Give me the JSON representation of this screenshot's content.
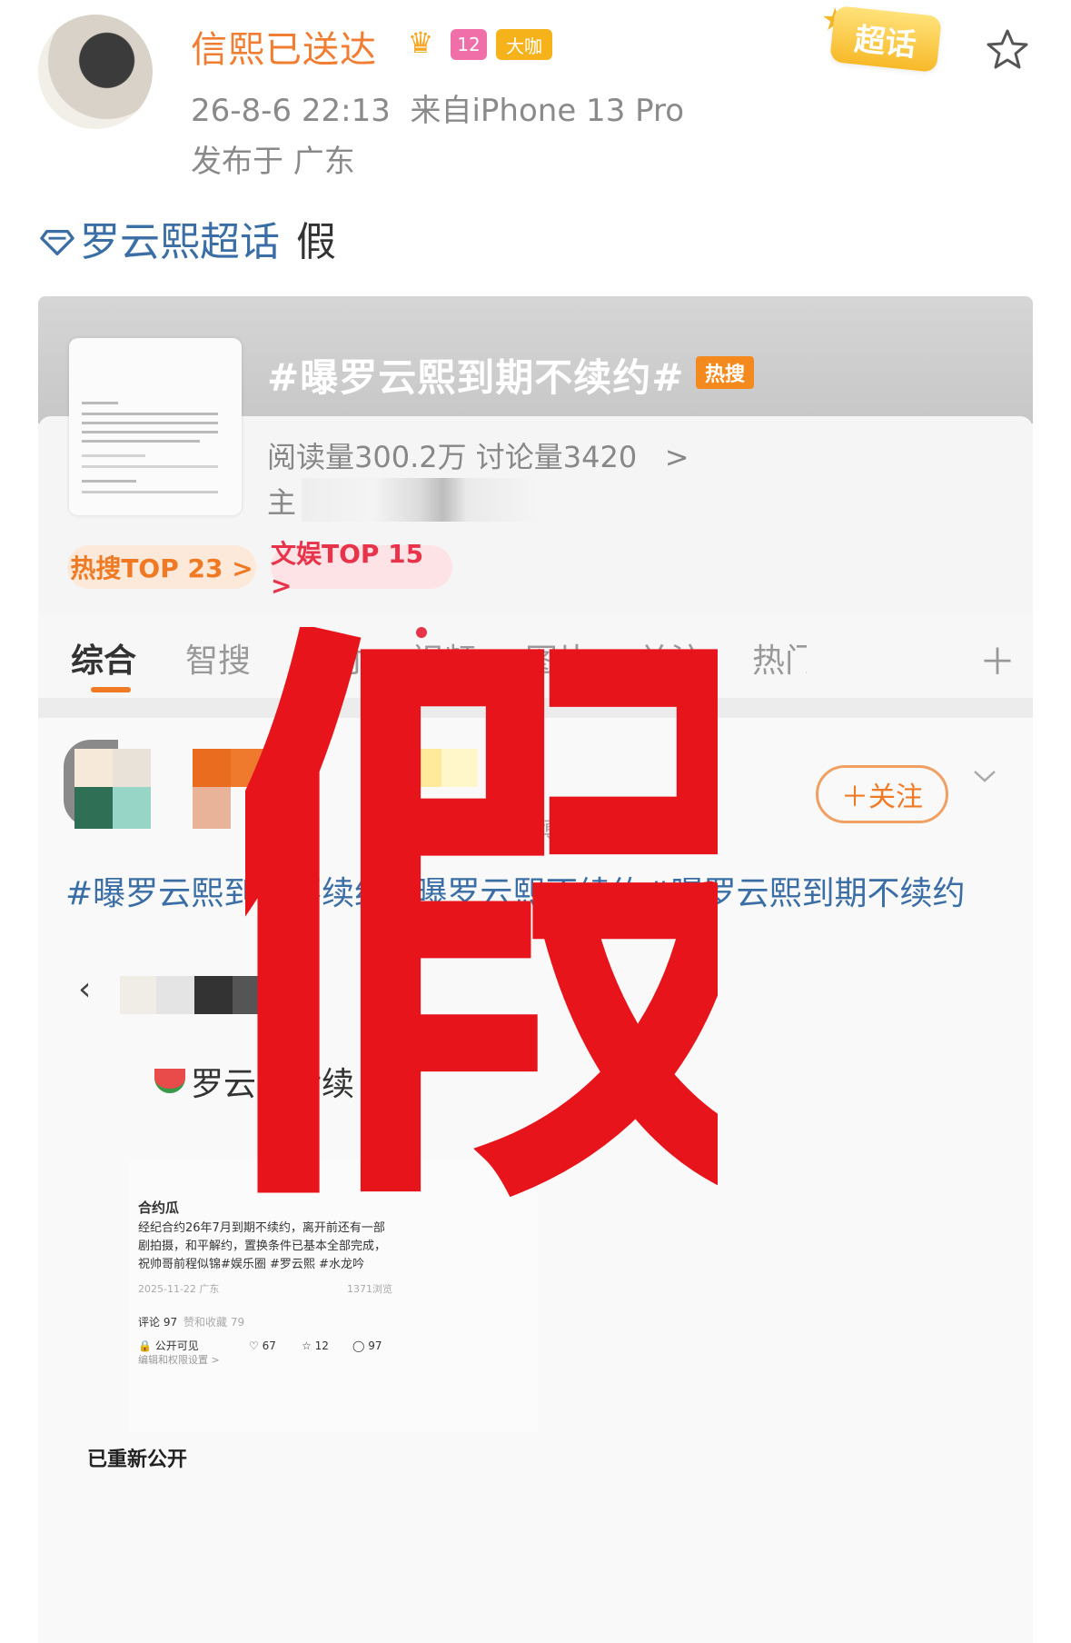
{
  "header": {
    "username": "信熙已送达",
    "level_badge": "12",
    "vip_badge": "大咖",
    "timestamp": "26-8-6 22:13",
    "source": "来自iPhone 13 Pro",
    "location": "发布于 广东",
    "chaohua_badge": "超话",
    "icons": [
      "avatar",
      "crown-icon",
      "level-icon",
      "chaohua-badge",
      "star-icon"
    ]
  },
  "topic": {
    "name": "罗云熙超话",
    "suffix": "假"
  },
  "screenshot": {
    "hashtag": "#曝罗云熙到期不续约#",
    "hot_tag": "热搜",
    "reads": "阅读量300.2万 讨论量3420",
    "reads_chevron": ">",
    "host_label": "主",
    "pills": [
      "热搜TOP 23 >",
      "文娱TOP 15 >"
    ],
    "tabs": [
      "综合",
      "智搜",
      "实时",
      "视频",
      "图片",
      "关注",
      "热门"
    ],
    "active_tab": 0,
    "follow_label": "＋关注",
    "member_label": "微博团成员",
    "post_text": "#曝罗云熙到期不续约#曝罗云熙不续约#曝罗云熙到期不续约",
    "inner_title": "罗云熙后续",
    "inner_post": {
      "author": "合约瓜",
      "body": "经纪合约26年7月到期不续约，离开前还有一部剧拍摄，和平解约，置换条件已基本全部完成，祝帅哥前程似锦#娱乐圈 #罗云熙 #水龙吟",
      "date": "2025-11-22 广东",
      "views": "1371浏览",
      "comments": "评论 97",
      "likes_fav": "赞和收藏 79",
      "visibility": "公开可见",
      "edit": "编辑和权限设置 >",
      "like_count": "67",
      "star_count": "12",
      "comment_count": "97"
    },
    "restored": "已重新公开"
  },
  "overlay": {
    "stamp": "假",
    "color": "#e8141b"
  },
  "colors": {
    "username": "#f07d32",
    "topic": "#3a6ea5",
    "accent": "#f07a24"
  }
}
